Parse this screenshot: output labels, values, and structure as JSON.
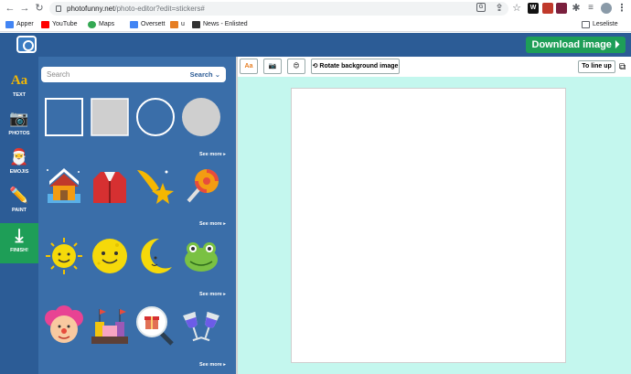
{
  "browser": {
    "url_host": "photofunny.net",
    "url_path": "/photo-editor?edit=stickers#",
    "bookmarks": [
      "Apper",
      "YouTube",
      "Maps",
      "Oversett",
      "u",
      "News - Enlisted"
    ],
    "reading_list": "Leseliste"
  },
  "header": {
    "download_label": "Download image ⏵"
  },
  "nav": {
    "items": [
      {
        "label": "TEXT",
        "icon": "text-icon"
      },
      {
        "label": "PHOTOS",
        "icon": "camera-icon"
      },
      {
        "label": "EMOJIS",
        "icon": "santa-emoji-icon"
      },
      {
        "label": "PAINT",
        "icon": "pencil-icon"
      },
      {
        "label": "FINISH!",
        "icon": "download-icon"
      }
    ]
  },
  "panel": {
    "search_placeholder": "Search",
    "search_button": "Search ⌄",
    "see_more": "See more ▸"
  },
  "toolbar": {
    "rotate_label": "Rotate background image",
    "line_up_label": "To line up"
  },
  "colors": {
    "header": "#2c5c96",
    "panel": "#3a6ea9",
    "accent_green": "#1e9e57",
    "canvas_bg": "#c4f7ee"
  }
}
